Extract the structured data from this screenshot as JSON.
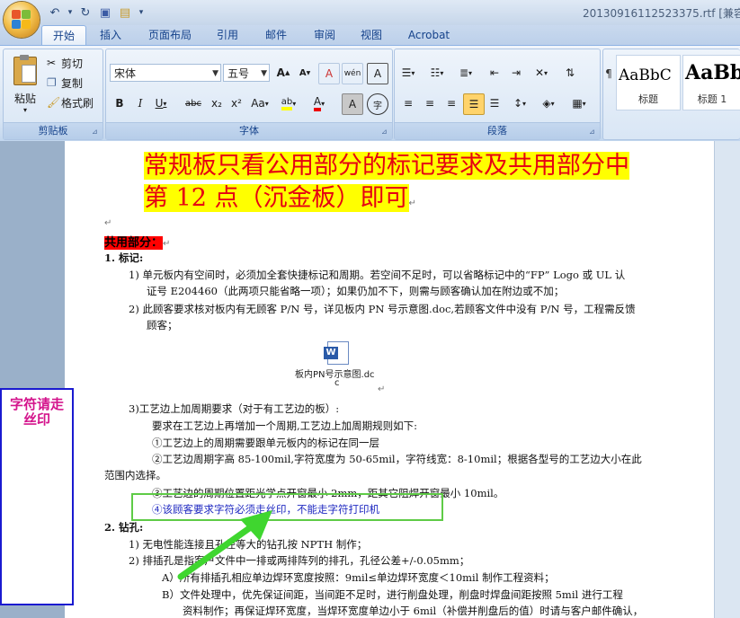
{
  "window": {
    "title": "20130916112523375.rtf [兼容模",
    "office_button": "office-button"
  },
  "quick_access": {
    "undo": "↶",
    "undo_dropdown": "▾",
    "redo": "↻",
    "save": "▣",
    "open": "▤",
    "customize": "▾"
  },
  "tabs": [
    "开始",
    "插入",
    "页面布局",
    "引用",
    "邮件",
    "审阅",
    "视图",
    "Acrobat"
  ],
  "ribbon": {
    "clipboard": {
      "paste": "粘贴",
      "cut": "剪切",
      "copy": "复制",
      "format_painter": "格式刷",
      "label": "剪贴板"
    },
    "font": {
      "font_name": "宋体",
      "font_size": "五号",
      "grow": "A",
      "shrink": "A",
      "clear": "A",
      "phonetic": "wén",
      "border_char": "A",
      "bold": "B",
      "italic": "I",
      "underline": "U",
      "strike": "abc",
      "subscript": "x₂",
      "superscript": "x²",
      "change_case": "Aa",
      "highlight": "ab",
      "font_color": "A",
      "char_shading": "A",
      "enclose": "字",
      "label": "字体"
    },
    "paragraph": {
      "label": "段落"
    },
    "styles": {
      "cards": [
        {
          "sample": "AaBbC",
          "name": "标题"
        },
        {
          "sample": "AaBb",
          "name": "标题 1"
        }
      ]
    }
  },
  "document": {
    "heading_line1": "常规板只看公用部分的标记要求及共用部分中",
    "heading_line2": "第 12 点（沉金板）即可",
    "section_title": "共用部分：",
    "item1_title": "1.   标记:",
    "item1_1_a": "1)  单元板内有空间时，必须加全套快捷标记和周期。若空间不足时，可以省略标记中的“FP” Logo 或 UL 认",
    "item1_1_b": "证号 E204460（此两项只能省略一项）；如果仍加不下，则需与顾客确认加在附边或不加；",
    "item1_2_a": "2)  此顾客要求核对板内有无顾客 P/N 号，详见板内 PN 号示意图.doc,若顾客文件中没有 P/N 号，工程需反馈",
    "item1_2_b": "顾客；",
    "embedded_file_line1": "板内PN号示意图.dc",
    "embedded_file_line2": "c",
    "item3_title": "3)工艺边上加周期要求（对于有工艺边的板）:",
    "item3_line1": "要求在工艺边上再增加一个周期,工艺边上加周期规则如下:",
    "item3_c1": "①工艺边上的周期需要跟单元板内的标记在同一层",
    "item3_c2_a": "②工艺边周期字高 85-100mil,字符宽度为 50-65mil，字符线宽：8-10mil；根据各型号的工艺边大小在此",
    "item3_c2_b": "范围内选择。",
    "item3_c3": "③工艺边的周期位置距光学点开窗最小 2mm，距其它阻焊开窗最小 10mil。",
    "item3_c4": "④该顾客要求字符必须走丝印，不能走字符打印机",
    "item2_title": "2.   钻孔:",
    "item2_1": "1)  无电性能连接且孔径等大的钻孔按 NPTH 制作；",
    "item2_2": "2)  排插孔是指客户文件中一排或两排阵列的排孔，孔径公差+/-0.05mm；",
    "item2_A": "A）所有排插孔相应单边焊环宽度按照：9mil≤单边焊环宽度＜10mil 制作工程资料；",
    "item2_B_a": "B）文件处理中，优先保证间距，当间距不足时，进行削盘处理，削盘时焊盘间距按照 5mil 进行工程",
    "item2_B_b": "资料制作；再保证焊环宽度，当焊环宽度单边小于 6mil（补偿并削盘后的值）时请与客户邮件确认，"
  },
  "annotation": {
    "note": "字符请走丝印"
  },
  "colors": {
    "heading_text": "#e60012",
    "heading_highlight": "#ffff00",
    "note_border": "#1a1ad0",
    "note_text": "#d4148c",
    "green_arrow": "#3fd62f"
  }
}
